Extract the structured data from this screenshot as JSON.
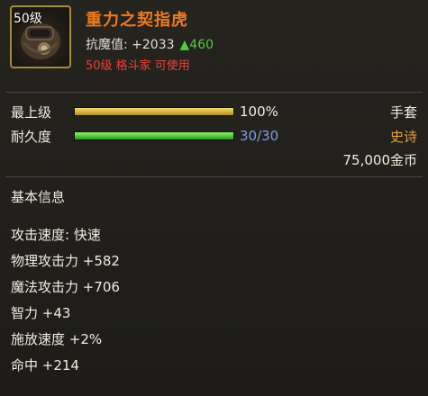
{
  "item": {
    "level_badge": "50级",
    "name": "重力之契指虎",
    "resist_label": "抗魔值: +2033",
    "resist_bonus": "▲460",
    "requirement": "50级 格斗家 可使用"
  },
  "stats": {
    "grade": {
      "label": "最上级",
      "value": "100%",
      "fill": 100,
      "right": "手套"
    },
    "durability": {
      "label": "耐久度",
      "value": "30/30",
      "fill": 100,
      "right": "史诗"
    },
    "price": "75,000金币"
  },
  "section": {
    "title": "基本信息"
  },
  "attributes": [
    "攻击速度: 快速",
    "物理攻击力 +582",
    "魔法攻击力 +706",
    "智力 +43",
    "施放速度 +2%",
    "命中 +214"
  ],
  "colors": {
    "title": "#f07a1c",
    "epic": "#e8a33a",
    "durability_value": "#7f9be0",
    "requirement": "#e84238"
  },
  "icons": {
    "item": "knuckle-gauntlet-icon"
  }
}
